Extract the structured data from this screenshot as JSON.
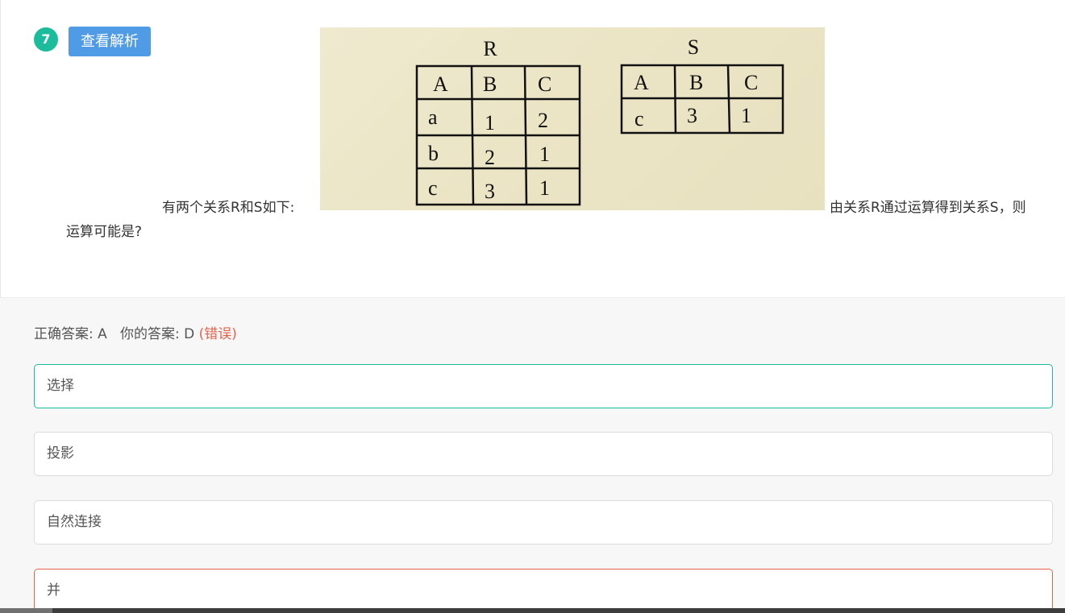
{
  "question": {
    "number": "7",
    "analysis_button": "查看解析",
    "text_before": "有两个关系R和S如下:",
    "text_after": "由关系R通过运算得到关系S，则",
    "text_after_line2": "运算可能是?",
    "image": {
      "relation_r": {
        "name": "R",
        "headers": [
          "A",
          "B",
          "C"
        ],
        "rows": [
          [
            "a",
            "1",
            "2"
          ],
          [
            "b",
            "2",
            "1"
          ],
          [
            "c",
            "3",
            "1"
          ]
        ]
      },
      "relation_s": {
        "name": "S",
        "headers": [
          "A",
          "B",
          "C"
        ],
        "rows": [
          [
            "c",
            "3",
            "1"
          ]
        ]
      }
    }
  },
  "answer": {
    "correct_label": "正确答案: A",
    "yours_label": "你的答案: D",
    "result": "(错误)"
  },
  "options": [
    {
      "label": "选择",
      "state": "correct"
    },
    {
      "label": "投影",
      "state": "normal"
    },
    {
      "label": "自然连接",
      "state": "normal"
    },
    {
      "label": "并",
      "state": "wrong"
    }
  ],
  "colors": {
    "accent": "#1abc9c",
    "button": "#4f9be6",
    "error": "#e7624a"
  }
}
